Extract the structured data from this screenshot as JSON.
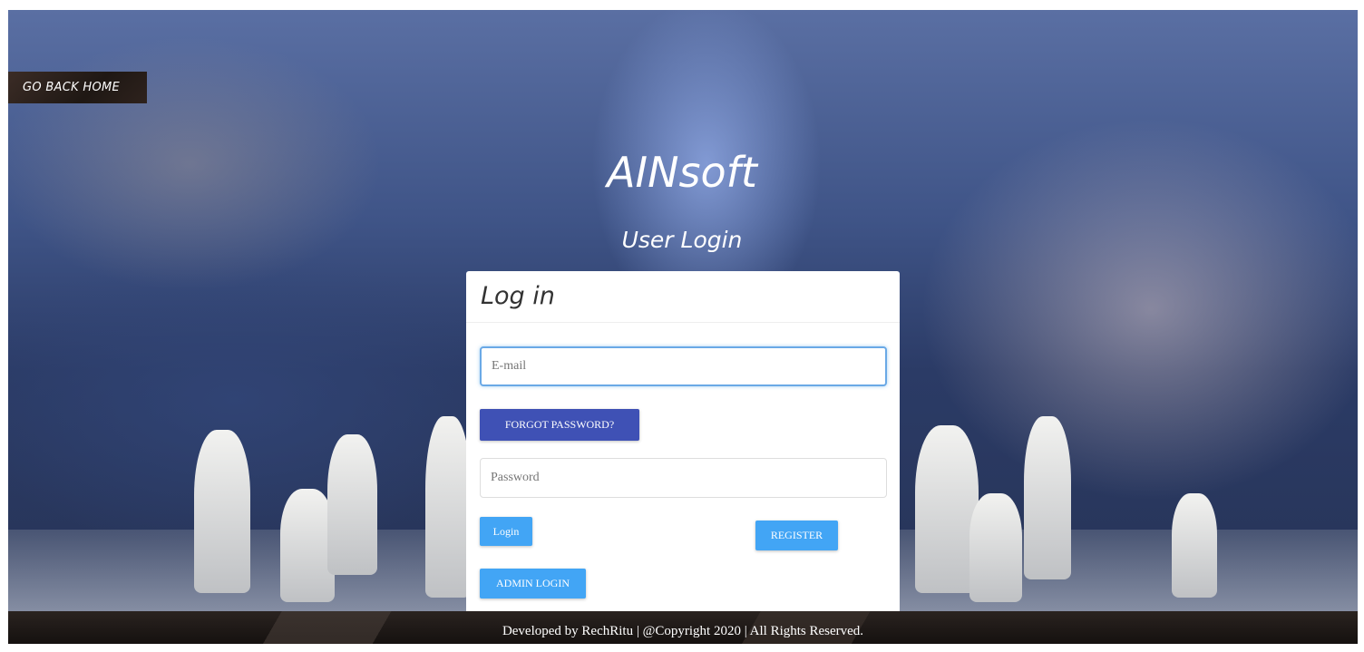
{
  "nav": {
    "home_label": "GO BACK HOME"
  },
  "brand": {
    "name": "AINsoft",
    "subtitle": "User Login"
  },
  "login_card": {
    "title": "Log in",
    "email_placeholder": "E-mail",
    "password_placeholder": "Password",
    "forgot_label": "FORGOT PASSWORD?",
    "login_label": "Login",
    "register_label": "REGISTER",
    "admin_label": "ADMIN LOGIN"
  },
  "footer": {
    "text": "Developed by RechRitu | @Copyright 2020 | All Rights Reserved."
  },
  "colors": {
    "primary_indigo": "#3f51b5",
    "button_blue": "#42a5f5",
    "focus_border": "#6aa9e6"
  }
}
